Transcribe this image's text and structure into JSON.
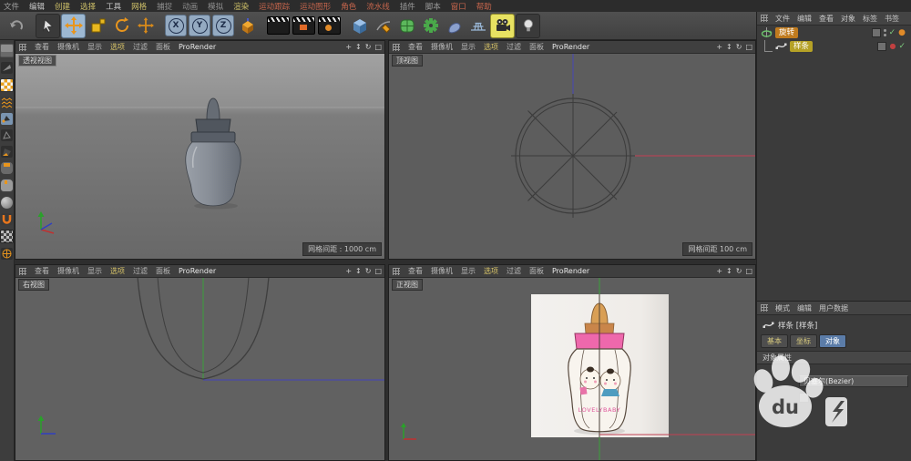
{
  "menubar": {
    "items": [
      {
        "label": "文件",
        "color": "#a0a0a0"
      },
      {
        "label": "编辑",
        "color": "#c8c8c8"
      },
      {
        "label": "创建",
        "color": "#cdbf68"
      },
      {
        "label": "选择",
        "color": "#cdbf68"
      },
      {
        "label": "工具",
        "color": "#c8c8c8"
      },
      {
        "label": "网格",
        "color": "#cdbf68"
      },
      {
        "label": "捕捉",
        "color": "#8f8f8f"
      },
      {
        "label": "动画",
        "color": "#8f8f8f"
      },
      {
        "label": "模拟",
        "color": "#8f8f8f"
      },
      {
        "label": "渲染",
        "color": "#cdbf68"
      },
      {
        "label": "运动跟踪",
        "color": "#c4654c"
      },
      {
        "label": "运动图形",
        "color": "#c4654c"
      },
      {
        "label": "角色",
        "color": "#c4654c"
      },
      {
        "label": "流水线",
        "color": "#c4654c"
      },
      {
        "label": "插件",
        "color": "#9a9a9a"
      },
      {
        "label": "脚本",
        "color": "#9a9a9a"
      },
      {
        "label": "窗口",
        "color": "#c4654c"
      },
      {
        "label": "帮助",
        "color": "#c4654c"
      }
    ]
  },
  "toolbar": {
    "icons": [
      "undo-icon",
      "live-selection-icon",
      "move-tool-icon",
      "scale-tool-icon",
      "rotate-tool-icon",
      "last-tool-icon",
      "lock-x-icon",
      "lock-y-icon",
      "lock-z-icon",
      "coordinate-system-icon",
      "render-view-icon",
      "render-settings-icon",
      "render-queue-icon",
      "primitive-cube-icon",
      "spline-pen-icon",
      "subdivision-surface-icon",
      "modeling-generator-icon",
      "spline-primitive-icon",
      "array-grid-icon",
      "camera-icon",
      "light-icon"
    ],
    "axis_labels": [
      "X",
      "Y",
      "Z"
    ]
  },
  "left_toolbar": {
    "icons": [
      "make-editable-icon",
      "model-mode-icon",
      "texture-mode-icon",
      "workplane-icon",
      "points-mode-icon",
      "edges-mode-icon",
      "polygons-mode-icon",
      "corner-mode-icon",
      "mouse-input-icon",
      "sphere-mode-icon",
      "magnet-snap-icon",
      "texture-p-icon",
      "axis-mode-icon"
    ]
  },
  "viewports": {
    "menu": [
      {
        "label": "查看",
        "color": "#b8b8b8"
      },
      {
        "label": "摄像机",
        "color": "#b8b8b8"
      },
      {
        "label": "显示",
        "color": "#b8b8b8"
      },
      {
        "label": "选项",
        "color": "#d8c468"
      },
      {
        "label": "过滤",
        "color": "#b8b8b8"
      },
      {
        "label": "面板",
        "color": "#b8b8b8"
      }
    ],
    "prorender": "ProRender",
    "prorender_color": "#eaeaea",
    "corner_icons": [
      {
        "name": "pan-icon",
        "glyph": "+"
      },
      {
        "name": "zoom-icon",
        "glyph": "↕"
      },
      {
        "name": "rotate-icon",
        "glyph": "↻"
      },
      {
        "name": "maximize-icon",
        "glyph": "□"
      }
    ],
    "perspective": {
      "label": "透视视图",
      "grid_label": "网格间距 : 1000 cm"
    },
    "top": {
      "label": "顶视图",
      "grid_label": "网格间距   100 cm"
    },
    "right": {
      "label": "右视图"
    },
    "front": {
      "label": "正视图",
      "bottle_text": "LOVELYBABY"
    }
  },
  "object_manager": {
    "menu": [
      "文件",
      "编辑",
      "查看",
      "对象",
      "标签",
      "书签"
    ],
    "objects": [
      {
        "name": "旋转",
        "name_bg": "#c07b1e",
        "icon": "lathe-icon"
      },
      {
        "name": "样条",
        "name_bg": "#b5a126",
        "icon": "spline-icon"
      }
    ]
  },
  "attribute_manager": {
    "menu": [
      "模式",
      "编辑",
      "用户数据"
    ],
    "title": "样条 [样条]",
    "tabs": [
      "基本",
      "坐标",
      "对象"
    ],
    "active_tab": "对象",
    "section": "对象属性",
    "type_value": "贝塞尔(Bezier)"
  },
  "watermark": {
    "du": "du"
  },
  "colors": {
    "accent_selected_tab": "#5b7ca8",
    "selected_object_highlight": "#c07b1e",
    "axis_x": "#c24052",
    "axis_y": "#3aa03a",
    "axis_z": "#4747b8",
    "option_menu_highlight": "#d8c468",
    "bottle_cap_pink": "#ee68ac",
    "bottle_nipple_tan": "#d99f55"
  }
}
